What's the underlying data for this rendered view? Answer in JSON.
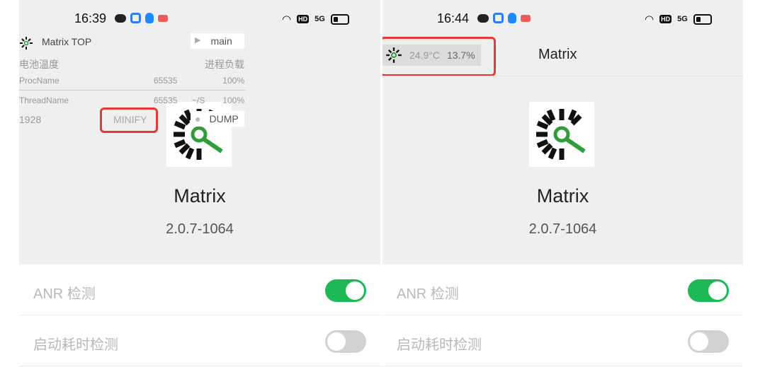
{
  "left": {
    "status": {
      "time": "16:39",
      "hd": "HD",
      "signal": "5G"
    },
    "overlay": {
      "title": "Matrix TOP",
      "main_label": "main",
      "battery_temp_label": "电池温度",
      "process_load_label": "进程负载",
      "proc_name": "ProcName",
      "proc_value": "65535",
      "proc_percent": "100%",
      "thread_name": "ThreadName",
      "thread_value": "65535",
      "thread_rate": "~/S",
      "thread_percent": "100%",
      "pid": "1928",
      "minify_label": "MINIFY",
      "dump_label": "DUMP"
    },
    "app": {
      "name": "Matrix",
      "version": "2.0.7-1064"
    },
    "settings": [
      {
        "label": "ANR 检测",
        "enabled": true
      },
      {
        "label": "启动耗时检测",
        "enabled": false
      }
    ]
  },
  "right": {
    "status": {
      "time": "16:44",
      "hd": "HD",
      "signal": "5G"
    },
    "chip": {
      "temperature": "24.9°C",
      "load": "13.7%"
    },
    "header_title": "Matrix",
    "app": {
      "name": "Matrix",
      "version": "2.0.7-1064"
    },
    "settings": [
      {
        "label": "ANR 检测",
        "enabled": true
      },
      {
        "label": "启动耗时检测",
        "enabled": false
      }
    ]
  },
  "colors": {
    "toggle_on": "#1db954",
    "toggle_off": "#d2d2d2",
    "highlight": "#e53935"
  },
  "icons": [
    "matrix-logo-icon",
    "wechat-icon",
    "app-square-icon",
    "qq-icon",
    "game-icon",
    "wifi-icon",
    "battery-icon",
    "play-icon",
    "record-dot-icon"
  ]
}
